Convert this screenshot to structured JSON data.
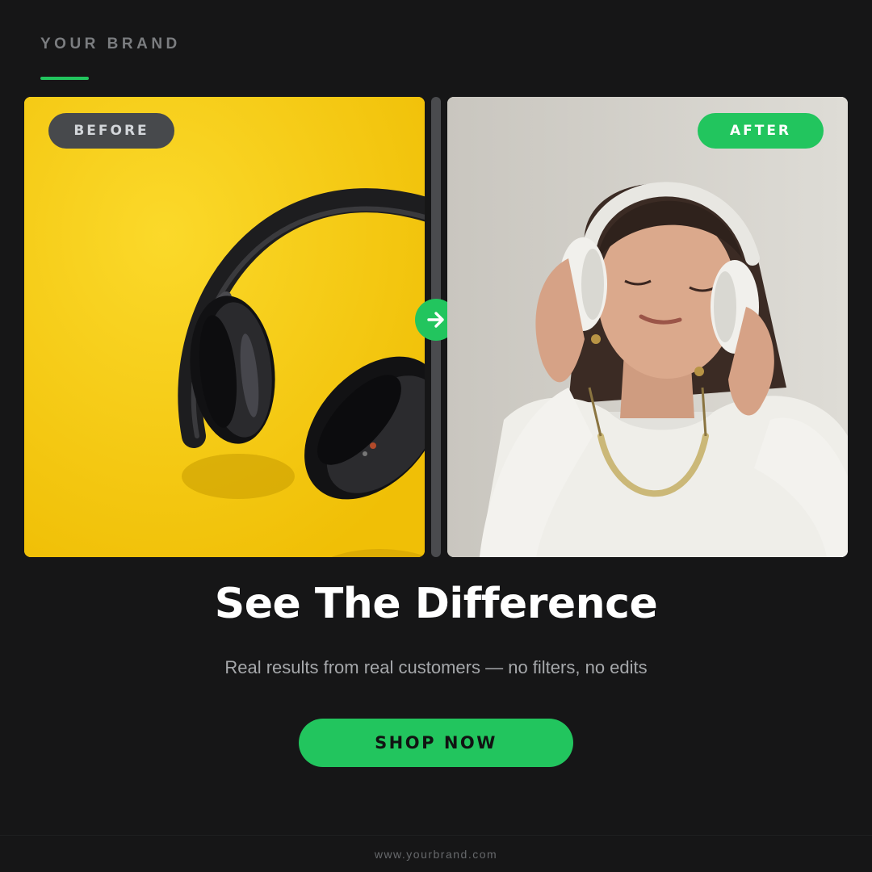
{
  "brand": {
    "name": "YOUR BRAND",
    "accent": "#22c55e"
  },
  "comparison": {
    "before": {
      "label": "BEFORE",
      "image": "yellow-headphones-photo"
    },
    "after": {
      "label": "AFTER",
      "image": "woman-wearing-headphones-photo"
    },
    "divider_icon": "arrow-right-icon"
  },
  "headline": "See The Difference",
  "subheadline": "Real results from real customers — no filters, no edits",
  "cta": {
    "label": "SHOP NOW"
  },
  "footer": {
    "url": "www.yourbrand.com"
  },
  "colors": {
    "background": "#161617",
    "accent": "#22c55e",
    "before_pill": "#47494c",
    "before_bg": "#f5cb12",
    "after_bg": "#d2d0ca"
  }
}
